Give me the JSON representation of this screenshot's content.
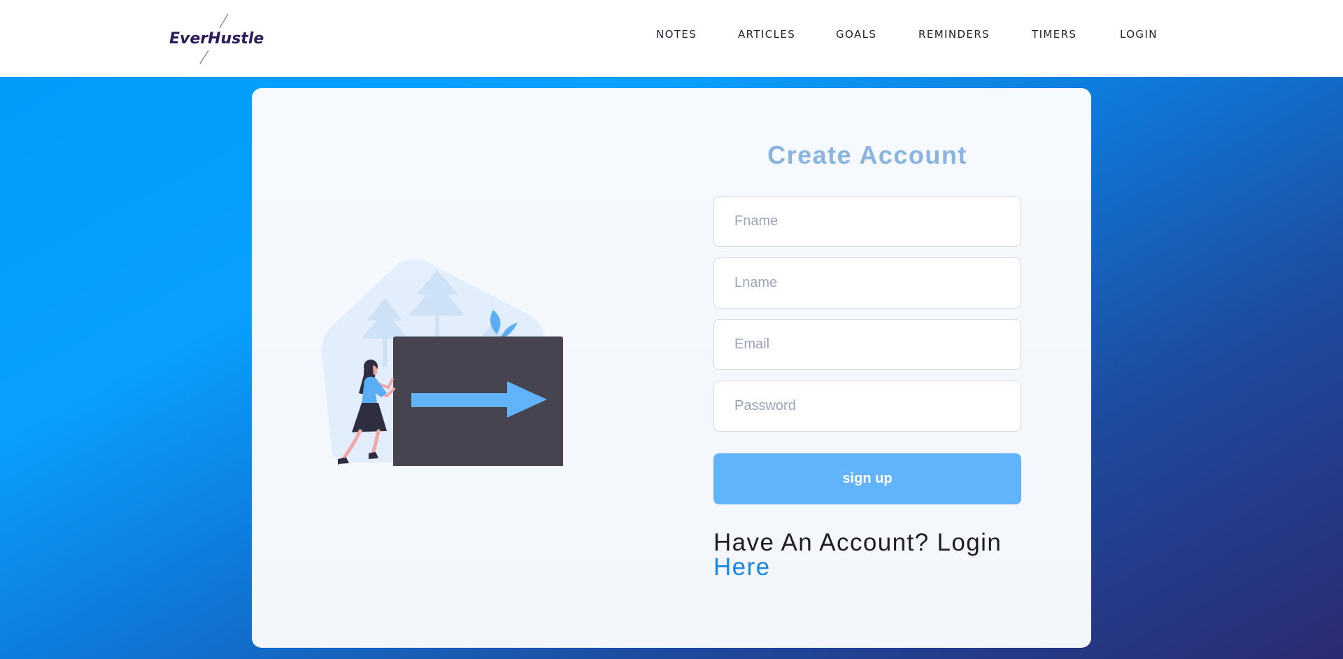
{
  "brand": {
    "name": "EverHustle"
  },
  "nav": {
    "links": [
      {
        "label": "NOTES"
      },
      {
        "label": "ARTICLES"
      },
      {
        "label": "GOALS"
      },
      {
        "label": "REMINDERS"
      },
      {
        "label": "TIMERS"
      },
      {
        "label": "LOGIN"
      }
    ]
  },
  "form": {
    "title": "Create Account",
    "fields": {
      "fname": {
        "placeholder": "Fname",
        "value": ""
      },
      "lname": {
        "placeholder": "Lname",
        "value": ""
      },
      "email": {
        "placeholder": "Email",
        "value": ""
      },
      "password": {
        "placeholder": "Password",
        "value": ""
      }
    },
    "submit_label": "sign up",
    "login_prompt": "Have An Account? Login",
    "login_link": "Here"
  },
  "colors": {
    "brand_text": "#2e1a5c",
    "accent_button": "#62b4fa",
    "title": "#8ab4e0",
    "link": "#1b86e8",
    "gradient_start": "#019dfb",
    "gradient_end": "#2b2a72"
  },
  "icons": {
    "illustration": "woman-pushing-arrow-box-illustration"
  }
}
